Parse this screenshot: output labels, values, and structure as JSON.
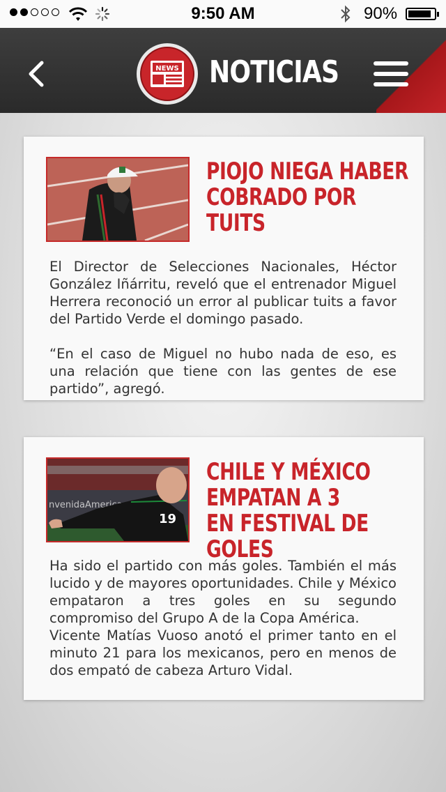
{
  "status_bar": {
    "time": "9:50 AM",
    "battery_percent_label": "90%",
    "battery_level": 0.9,
    "signal_bars": 2,
    "signal_total": 5
  },
  "header": {
    "title": "NOTICIAS",
    "logo_text": "NEWS",
    "back_icon": "chevron-left-icon",
    "menu_icon": "hamburger-menu-icon",
    "accent_color": "#c8252a"
  },
  "articles": [
    {
      "headline": "PIOJO NIEGA HABER COBRADO POR TUITS",
      "paragraphs": [
        "El Director de Selecciones Nacionales, Héctor González Iñárritu, reveló que el entrenador Miguel Herrera reconoció un error al publicar tuits a favor del Partido Verde el domingo pasado.",
        "“En el caso de Miguel no hubo nada de eso, es una relación que tiene con las gentes de ese partido”, agregó."
      ]
    },
    {
      "headline_lines": [
        "CHILE Y MÉXICO",
        "EMPATAN A 3",
        "EN FESTIVAL DE GOLES"
      ],
      "thumb_text": "nvenidaAmerica",
      "jersey_number": "19",
      "paragraphs": [
        "Ha sido el partido con más goles. También el más lucido y de mayores oportunidades. Chile y México empataron a tres goles en su segundo compromiso del Grupo A de la Copa América.",
        "Vicente Matías Vuoso anotó el primer tanto en el minuto 21 para los mexicanos, pero en menos de dos empató de cabeza Arturo Vidal."
      ]
    }
  ]
}
